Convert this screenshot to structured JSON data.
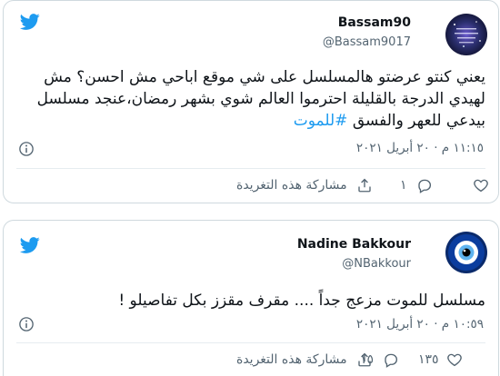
{
  "tweets": [
    {
      "user_name": "Bassam90",
      "handle": "@Bassam9017",
      "avatar_icon": "galaxy-avatar",
      "text_main": "يعني كنتو عرضتو  هالمسلسل على شي موقع اباحي مش احسن؟ مش لهيدي الدرجة بالقليلة احترموا العالم شوي بشهر رمضان،عنجد  مسلسل بيدعي للعهر والفسق",
      "hashtag": "#للموت",
      "timestamp": "١١:١٥ م · ٢٠ أبريل ٢٠٢١",
      "like_count": "",
      "reply_count": "١",
      "share_label": "مشاركة هذه التغريدة"
    },
    {
      "user_name": "Nadine Bakkour",
      "handle": "@NBakkour",
      "avatar_icon": "evil-eye-avatar",
      "text_main": "مسلسل للموت مزعج جداً .... مقرف مقزز بكل تفاصيلو !",
      "hashtag": "",
      "timestamp": "١٠:٥٩ م · ٢٠ أبريل ٢٠٢١",
      "like_count": "١٣٥",
      "reply_count": "١٥",
      "share_label": "مشاركة هذه التغريدة"
    }
  ],
  "colors": {
    "accent": "#1d9bf0",
    "muted": "#536471",
    "border": "#cfd9de"
  },
  "icons": [
    "twitter-bird-icon",
    "info-icon",
    "heart-icon",
    "reply-icon",
    "share-icon"
  ]
}
